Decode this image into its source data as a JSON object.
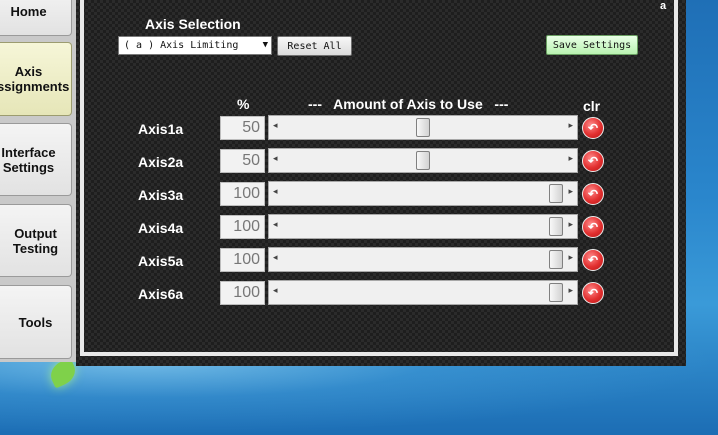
{
  "nav": {
    "home": "Home",
    "axis_assignments": "Axis\nAssignments",
    "interface_settings": "Interface\nSettings",
    "output_testing": "Output\nTesting",
    "tools": "Tools"
  },
  "corner_label": "a",
  "axis_selection": {
    "title": "Axis Selection",
    "selected": "( a ) Axis Limiting"
  },
  "buttons": {
    "reset_all": "Reset All",
    "save_settings": "Save Settings"
  },
  "headers": {
    "percent": "%",
    "amount": "---   Amount of Axis to Use   ---",
    "clr": "clr"
  },
  "axes": [
    {
      "name": "Axis1a",
      "value": "50",
      "level": 0.5
    },
    {
      "name": "Axis2a",
      "value": "50",
      "level": 0.5
    },
    {
      "name": "Axis3a",
      "value": "100",
      "level": 1.0
    },
    {
      "name": "Axis4a",
      "value": "100",
      "level": 1.0
    },
    {
      "name": "Axis5a",
      "value": "100",
      "level": 1.0
    },
    {
      "name": "Axis6a",
      "value": "100",
      "level": 1.0
    }
  ],
  "icons": {
    "clear": "undo-arrow-icon",
    "slider_left": "left-arrow-icon",
    "slider_right": "right-arrow-icon",
    "dropdown": "chevron-down-icon"
  },
  "colors": {
    "panel_bg": "#2b2b2b",
    "save_button": "#b9f2b0",
    "clear_button": "#e23030",
    "active_nav": "#e6e6b8"
  }
}
